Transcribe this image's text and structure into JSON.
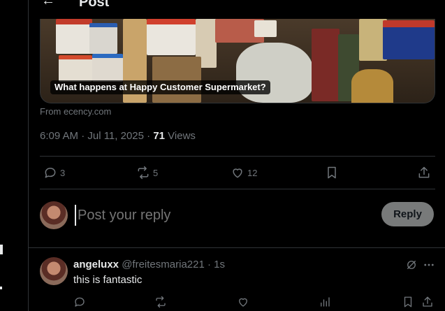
{
  "header": {
    "title": "Post",
    "back_icon": "arrow-left-icon"
  },
  "media": {
    "caption": "What happens at Happy Customer Supermarket?",
    "source": "From ecency.com"
  },
  "meta": {
    "timestamp": "6:09 AM · Jul 11, 2025 · ",
    "views_count": "71",
    "views_label": " Views"
  },
  "actions": {
    "replies": "3",
    "reposts": "5",
    "likes": "12"
  },
  "composer": {
    "placeholder": "Post your reply",
    "reply_label": "Reply"
  },
  "reply": {
    "name": "angeluxx",
    "handle": " @freitesmaria221 · 1s",
    "text": "this is fantastic"
  },
  "colors": {
    "background": "#000000",
    "text_primary": "#e7e9ea",
    "text_secondary": "#71767b",
    "divider": "#2f3336",
    "reply_button_bg": "#787a7a"
  }
}
